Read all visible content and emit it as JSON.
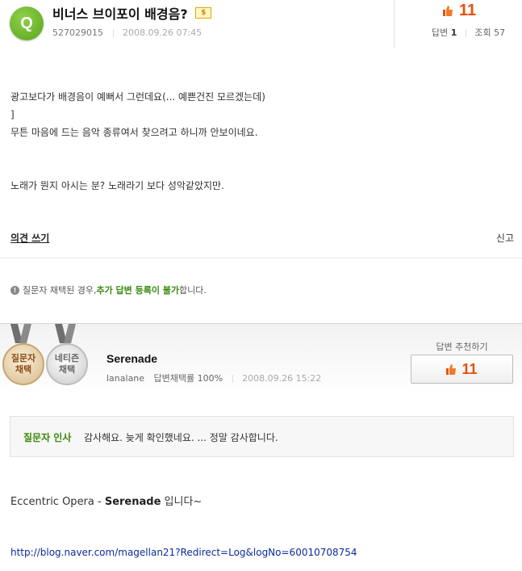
{
  "question": {
    "badge": "Q",
    "title": "비너스 브이포이 배경음?",
    "coin_label": "$",
    "author": "527029015",
    "date": "2008.09.26 07:45",
    "recommend_count": "11",
    "answers_label": "답변",
    "answers_count": "1",
    "views_label": "조회",
    "views_count": "57",
    "body": [
      "광고보다가 배경음이 예뻐서 그런데요(... 예쁜건진 모르겠는데)",
      "]",
      "무튼 마음에 드는 음악 종류여서 찾으려고 하니까 안보이네요.",
      "노래가 뭔지 아시는 분? 노래라기 보다 성악같았지만."
    ]
  },
  "actions": {
    "opinion": "의견 쓰기",
    "report": "신고"
  },
  "notice": {
    "icon": "!",
    "before": "질문자 채택된 경우, ",
    "highlight": "추가 답변 등록이 불가",
    "after": "합니다."
  },
  "answer": {
    "medal_asker_line1": "질문자",
    "medal_asker_line2": "채택",
    "medal_netizen_line1": "네티즌",
    "medal_netizen_line2": "채택",
    "name": "Serenade",
    "user_id": "lanalane",
    "adoption_rate": "답변채택률 100%",
    "date": "2008.09.26 15:22",
    "recommend_label": "답변 추천하기",
    "recommend_count": "11",
    "greeting_label": "질문자 인사",
    "greeting_text": "감사해요. 늦게 확인했네요. ... 정말 감사합니다.",
    "body_prefix": "Eccentric Opera - ",
    "body_bold": "Serenade",
    "body_suffix": " 입니다~",
    "link": "http://blog.naver.com/magellan21?Redirect=Log&logNo=60010708754"
  },
  "colors": {
    "accent_green": "#3b8a0f",
    "count_orange": "#e8500a",
    "link_blue": "#0b2b9c"
  }
}
